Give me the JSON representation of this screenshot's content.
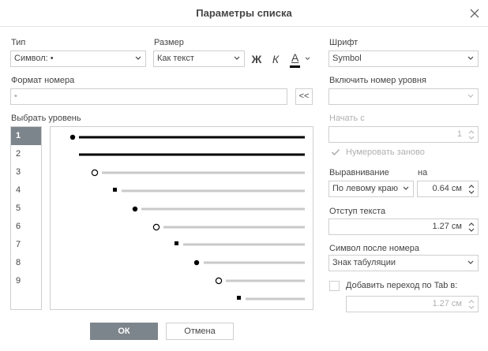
{
  "dialog": {
    "title": "Параметры списка"
  },
  "type": {
    "label": "Тип",
    "value": "Символ: •"
  },
  "size": {
    "label": "Размер",
    "value": "Как текст"
  },
  "format_buttons": {
    "bold": "Ж",
    "italic": "К",
    "color": "A"
  },
  "font": {
    "label": "Шрифт",
    "value": "Symbol"
  },
  "number_format": {
    "label": "Формат номера",
    "value": "•",
    "insert_button": "<<"
  },
  "include_level": {
    "label": "Включить номер уровня",
    "value": ""
  },
  "levels": {
    "label": "Выбрать уровень",
    "items": [
      "1",
      "2",
      "3",
      "4",
      "5",
      "6",
      "7",
      "8",
      "9"
    ],
    "selected": "1"
  },
  "start_at": {
    "label": "Начать с",
    "value": "1"
  },
  "restart": {
    "label": "Нумеровать заново",
    "checked": true
  },
  "alignment": {
    "label": "Выравнивание",
    "value": "По левому краю",
    "at_label": "на",
    "at_value": "0.64 см"
  },
  "indent": {
    "label": "Отступ текста",
    "value": "1.27 см"
  },
  "after_number": {
    "label": "Символ после номера",
    "value": "Знак табуляции"
  },
  "tab_stop": {
    "label": "Добавить переход по Tab в:",
    "checked": false,
    "value": "1.27 см"
  },
  "buttons": {
    "ok": "ОК",
    "cancel": "Отмена"
  },
  "colors": {
    "accent": "#7d858c",
    "border": "#cfcfcf",
    "disabled": "#b0b0b0"
  }
}
